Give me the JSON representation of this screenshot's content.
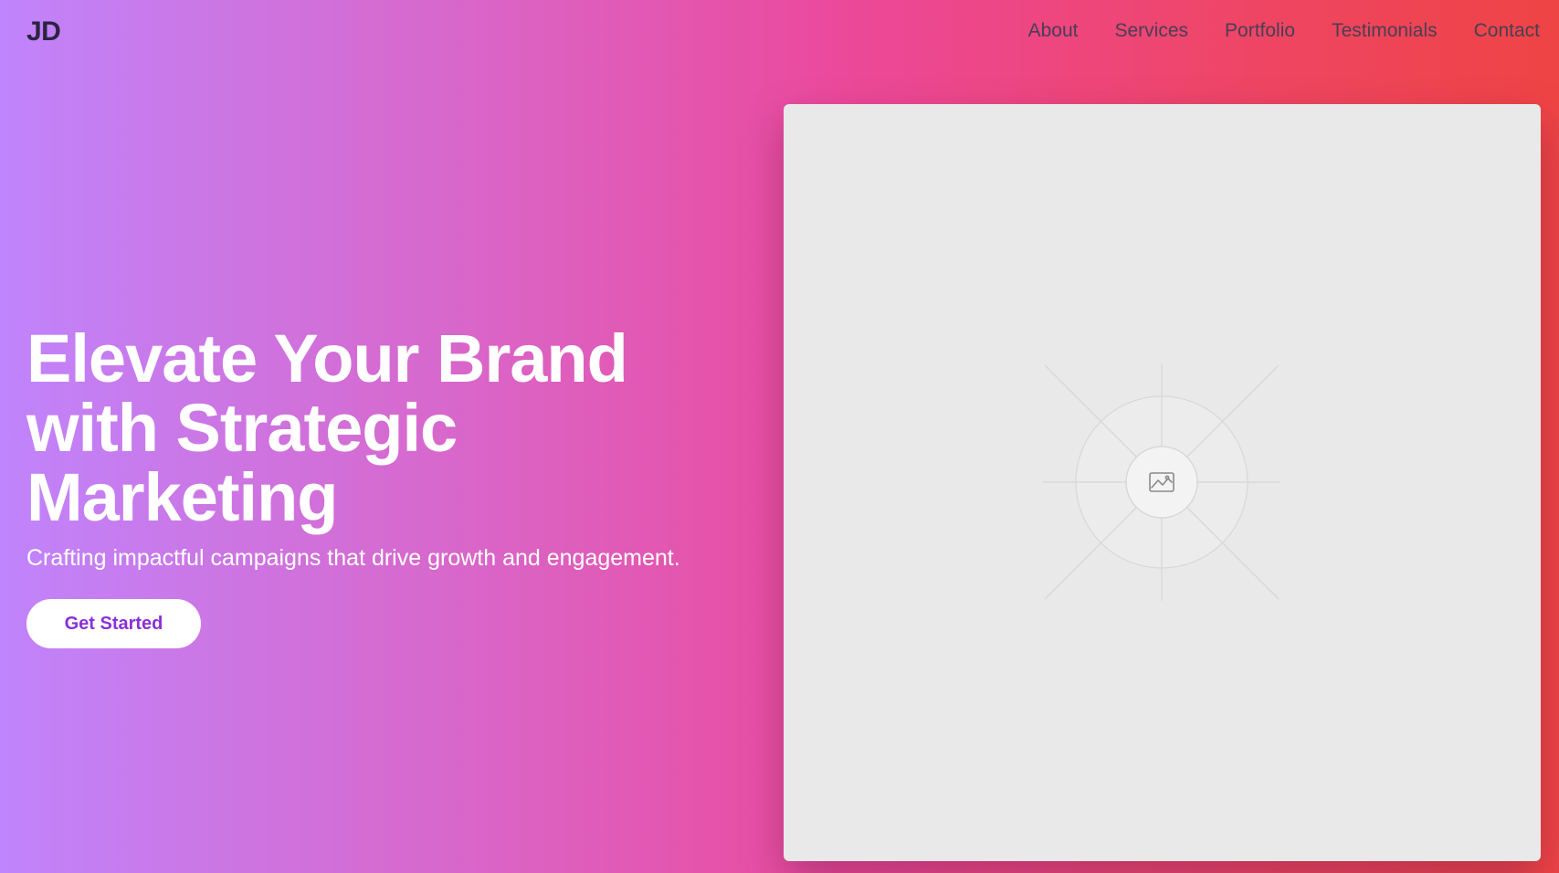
{
  "nav": {
    "logo": "JD",
    "links": [
      {
        "label": "About"
      },
      {
        "label": "Services"
      },
      {
        "label": "Portfolio"
      },
      {
        "label": "Testimonials"
      },
      {
        "label": "Contact"
      }
    ]
  },
  "hero": {
    "headline_line1": "Elevate Your Brand",
    "headline_line2": "with Strategic",
    "headline_line3": "Marketing",
    "subhead": "Crafting impactful campaigns that drive growth and engagement.",
    "cta_label": "Get Started"
  },
  "image_placeholder": {
    "icon": "image-icon"
  },
  "colors": {
    "gradient_start": "#c084fc",
    "gradient_mid": "#ec4899",
    "gradient_end": "#ef4444",
    "cta_text": "#8b2fd6",
    "placeholder_bg": "#e9e9e9"
  }
}
